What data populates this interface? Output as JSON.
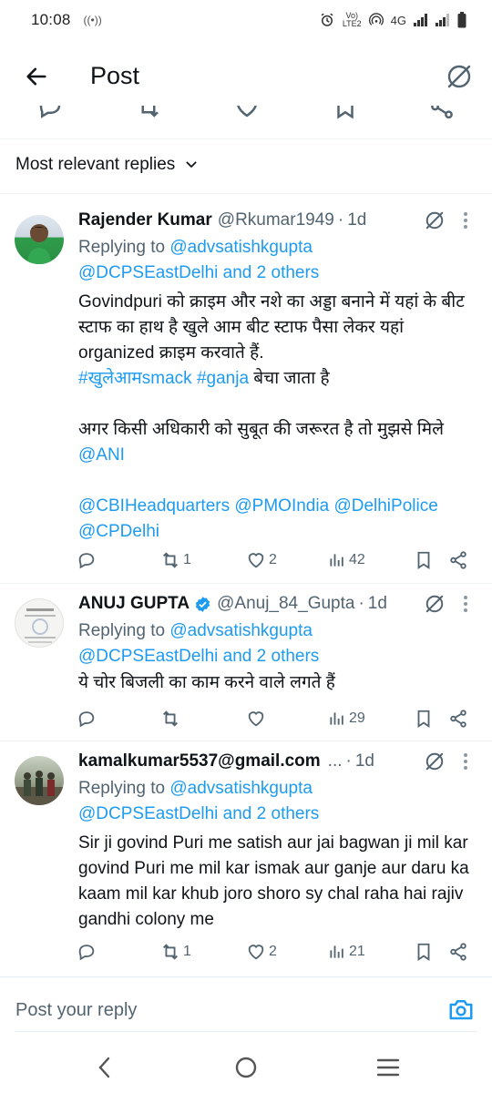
{
  "status_bar": {
    "time": "10:08",
    "network_badge_top": "Vo)",
    "network_badge_bottom": "LTE2",
    "network_type": "4G"
  },
  "header": {
    "title": "Post",
    "back_icon": "arrow-left-icon",
    "grok_icon": "grok-icon"
  },
  "sort": {
    "label": "Most relevant replies"
  },
  "replies": [
    {
      "display_name": "Rajender Kumar",
      "handle": "@Rkumar1949",
      "time": "1d",
      "verified": false,
      "replying_prefix": "Replying to ",
      "replying_user": "@advsatishkgupta",
      "replying_more": "@DCPSEastDelhi and 2 others",
      "body_line1": "Govindpuri को क्राइम और नशे का अड्डा बनाने में यहां के बीट स्टाफ का हाथ है खुले आम बीट स्टाफ पैसा लेकर यहां organized क्राइम करवाते हैं.",
      "hashtag1": "#खुलेआमsmack",
      "hashtag2": "#ganja",
      "hashtag_suffix": " बेचा जाता है",
      "body_line2": "अगर किसी अधिकारी को सुबूत की जरूरत है तो मुझसे मिले",
      "mention_ani": "@ANI",
      "mention_cbi": "@CBIHeadquarters",
      "mention_pmo": "@PMOIndia",
      "mention_dp": "@DelhiPolice",
      "mention_cp": "@CPDelhi",
      "replies_count": "",
      "reposts_count": "1",
      "likes_count": "2",
      "views_count": "42"
    },
    {
      "display_name": "ANUJ GUPTA",
      "handle": "@Anuj_84_Gupta",
      "time": "1d",
      "verified": true,
      "replying_prefix": "Replying to ",
      "replying_user": "@advsatishkgupta",
      "replying_more": "@DCPSEastDelhi and 2 others",
      "body": "ये चोर बिजली का काम करने वाले लगते हैं",
      "replies_count": "",
      "reposts_count": "",
      "likes_count": "",
      "views_count": "29"
    },
    {
      "display_name": "kamalkumar5537@gmail.com",
      "handle": "...",
      "time": "1d",
      "verified": false,
      "replying_prefix": "Replying to ",
      "replying_user": "@advsatishkgupta",
      "replying_more": "@DCPSEastDelhi and 2 others",
      "body": "Sir ji govind Puri me satish aur jai bagwan ji mil kar govind Puri me mil kar ismak aur ganje aur daru ka kaam mil kar khub joro shoro sy chal raha hai rajiv gandhi colony me",
      "replies_count": "",
      "reposts_count": "1",
      "likes_count": "2",
      "views_count": "21"
    }
  ],
  "composer": {
    "placeholder": "Post your reply"
  },
  "colors": {
    "link": "#1d9bf0",
    "secondary_text": "#536471",
    "primary_text": "#0f1419",
    "verified_badge": "#1d9bf0"
  }
}
